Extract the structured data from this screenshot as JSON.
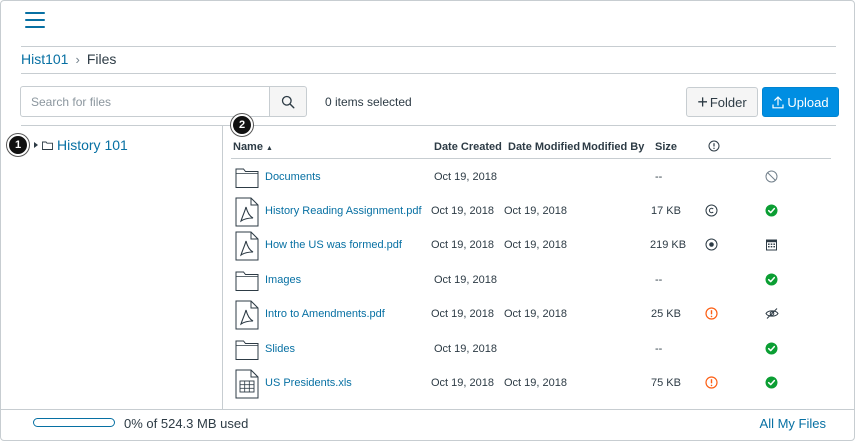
{
  "breadcrumb": {
    "course": "Hist101",
    "separator": "›",
    "current": "Files"
  },
  "search": {
    "placeholder": "Search for files",
    "value": ""
  },
  "toolbar": {
    "selected_text": "0 items selected",
    "folder_plus": "+",
    "folder_label": "Folder",
    "upload_label": "Upload"
  },
  "tree": {
    "root_label": "History 101"
  },
  "callouts": {
    "one": "1",
    "two": "2"
  },
  "table": {
    "headers": {
      "name": "Name",
      "sort_arrow": "▲",
      "created": "Date Created",
      "modified": "Date Modified",
      "modified_by": "Modified By",
      "size": "Size"
    },
    "rows": [
      {
        "name": "Documents",
        "type": "folder",
        "created": "Oct 19, 2018",
        "modified": "",
        "size": "--",
        "usage_icon": "",
        "status_icon": "restricted-icon"
      },
      {
        "name": "History Reading Assignment.pdf",
        "type": "pdf",
        "created": "Oct 19, 2018",
        "modified": "Oct 19, 2018",
        "size": "17 KB",
        "usage_icon": "copyright-icon",
        "status_icon": "published-check-icon"
      },
      {
        "name": "How the US was formed.pdf",
        "type": "pdf",
        "created": "Oct 19, 2018",
        "modified": "Oct 19, 2018",
        "size": "219 KB",
        "usage_icon": "creative-commons-icon",
        "status_icon": "calendar-icon"
      },
      {
        "name": "Images",
        "type": "folder",
        "created": "Oct 19, 2018",
        "modified": "",
        "size": "--",
        "usage_icon": "",
        "status_icon": "published-check-icon"
      },
      {
        "name": "Intro to Amendments.pdf",
        "type": "pdf",
        "created": "Oct 19, 2018",
        "modified": "Oct 19, 2018",
        "size": "25 KB",
        "usage_icon": "warning-icon",
        "status_icon": "hidden-eye-icon"
      },
      {
        "name": "Slides",
        "type": "folder",
        "created": "Oct 19, 2018",
        "modified": "",
        "size": "--",
        "usage_icon": "",
        "status_icon": "published-check-icon"
      },
      {
        "name": "US Presidents.xls",
        "type": "xls",
        "created": "Oct 19, 2018",
        "modified": "Oct 19, 2018",
        "size": "75 KB",
        "usage_icon": "warning-icon",
        "status_icon": "published-check-icon"
      }
    ]
  },
  "footer": {
    "quota_text": "0% of 524.3 MB used",
    "quota_percent": 0,
    "all_files_label": "All My Files"
  },
  "colors": {
    "link": "#0770a3",
    "primary": "#008ee2",
    "success": "#0b9e33",
    "warning": "#fc5e13",
    "border": "#c7cdd1",
    "text": "#2d3b45"
  }
}
